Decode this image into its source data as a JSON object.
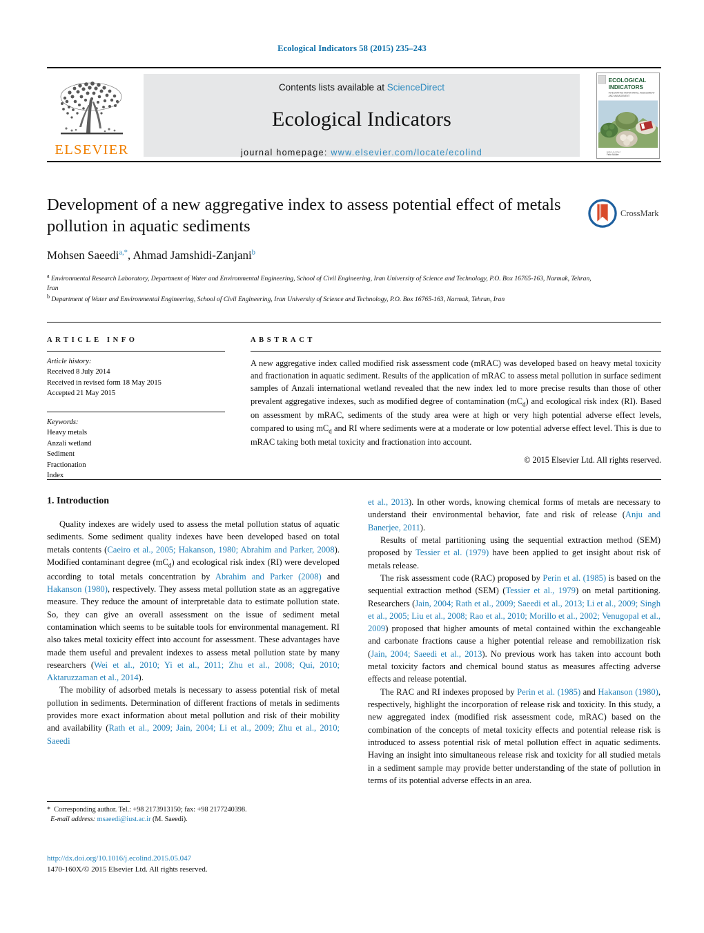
{
  "running_head": "Ecological Indicators 58 (2015) 235–243",
  "masthead": {
    "publisher_name": "ELSEVIER",
    "contents_prefix": "Contents lists available at ",
    "contents_link": "ScienceDirect",
    "journal_name": "Ecological Indicators",
    "homepage_prefix": "journal homepage: ",
    "homepage_url": "www.elsevier.com/locate/ecolind",
    "cover_title_line1": "ECOLOGICAL",
    "cover_title_line2": "INDICATORS",
    "cover_subtitle": "INTEGRATING MONITORING, ASSESSMENT AND MANAGEMENT"
  },
  "article": {
    "title": "Development of a new aggregative index to assess potential effect of metals pollution in aquatic sediments",
    "crossmark_label": "CrossMark",
    "authors_html": "Mohsen Saeedi<sup>a,*</sup>, Ahmad Jamshidi-Zanjani<sup>b</sup>",
    "affiliation_a": "Environmental Research Laboratory, Department of Water and Environmental Engineering, School of Civil Engineering, Iran University of Science and Technology, P.O. Box 16765-163, Narmak, Tehran, Iran",
    "affiliation_b": "Department of Water and Environmental Engineering, School of Civil Engineering, Iran University of Science and Technology, P.O. Box 16765-163, Narmak, Tehran, Iran"
  },
  "article_info": {
    "label": "ARTICLE INFO",
    "history_label": "Article history:",
    "history": [
      "Received 8 July 2014",
      "Received in revised form 18 May 2015",
      "Accepted 21 May 2015"
    ],
    "keywords_label": "Keywords:",
    "keywords": [
      "Heavy metals",
      "Anzali wetland",
      "Sediment",
      "Fractionation",
      "Index"
    ]
  },
  "abstract": {
    "label": "ABSTRACT",
    "text_html": "A new aggregative index called modified risk assessment code (mRAC) was developed based on heavy metal toxicity and fractionation in aquatic sediment. Results of the application of mRAC to assess metal pollution in surface sediment samples of Anzali international wetland revealed that the new index led to more precise results than those of other prevalent aggregative indexes, such as modified degree of contamination (mC<sub>d</sub>) and ecological risk index (RI). Based on assessment by mRAC, sediments of the study area were at high or very high potential adverse effect levels, compared to using mC<sub>d</sub> and RI where sediments were at a moderate or low potential adverse effect level. This is due to mRAC taking both metal toxicity and fractionation into account.",
    "copyright": "© 2015 Elsevier Ltd. All rights reserved."
  },
  "body": {
    "section_heading": "1. Introduction",
    "left_paragraphs_html": [
      "Quality indexes are widely used to assess the metal pollution status of aquatic sediments. Some sediment quality indexes have been developed based on total metals contents (<span class=\"cite\">Caeiro et al., 2005; Hakanson, 1980; Abrahim and Parker, 2008</span>). Modified contaminant degree (mC<sub>d</sub>) and ecological risk index (RI) were developed according to total metals concentration by <span class=\"cite\">Abrahim and Parker (2008)</span> and <span class=\"cite\">Hakanson (1980)</span>, respectively. They assess metal pollution state as an aggregative measure. They reduce the amount of interpretable data to estimate pollution state. So, they can give an overall assessment on the issue of sediment metal contamination which seems to be suitable tools for environmental management. RI also takes metal toxicity effect into account for assessment. These advantages have made them useful and prevalent indexes to assess metal pollution state by many researchers (<span class=\"cite\">Wei et al., 2010; Yi et al., 2011; Zhu et al., 2008; Qui, 2010; Aktaruzzaman et al., 2014</span>).",
      "The mobility of adsorbed metals is necessary to assess potential risk of metal pollution in sediments. Determination of different fractions of metals in sediments provides more exact information about metal pollution and risk of their mobility and availability (<span class=\"cite\">Rath et al., 2009; Jain, 2004; Li et al., 2009; Zhu et al., 2010; Saeedi</span>"
    ],
    "right_paragraphs_html": [
      "<span class=\"cite\">et al., 2013</span>). In other words, knowing chemical forms of metals are necessary to understand their environmental behavior, fate and risk of release (<span class=\"cite\">Anju and Banerjee, 2011</span>).",
      "Results of metal partitioning using the sequential extraction method (SEM) proposed by <span class=\"cite\">Tessier et al. (1979)</span> have been applied to get insight about risk of metals release.",
      "The risk assessment code (RAC) proposed by <span class=\"cite\">Perin et al. (1985)</span> is based on the sequential extraction method (SEM) (<span class=\"cite\">Tessier et al., 1979</span>) on metal partitioning. Researchers (<span class=\"cite\">Jain, 2004; Rath et al., 2009; Saeedi et al., 2013; Li et al., 2009; Singh et al., 2005; Liu et al., 2008; Rao et al., 2010; Morillo et al., 2002; Venugopal et al., 2009</span>) proposed that higher amounts of metal contained within the exchangeable and carbonate fractions cause a higher potential release and remobilization risk (<span class=\"cite\">Jain, 2004; Saeedi et al., 2013</span>). No previous work has taken into account both metal toxicity factors and chemical bound status as measures affecting adverse effects and release potential.",
      "The RAC and RI indexes proposed by <span class=\"cite\">Perin et al. (1985)</span> and <span class=\"cite\">Hakanson (1980)</span>, respectively, highlight the incorporation of release risk and toxicity. In this study, a new aggregated index (modified risk assessment code, mRAC) based on the combination of the concepts of metal toxicity effects and potential release risk is introduced to assess potential risk of metal pollution effect in aquatic sediments. Having an insight into simultaneous release risk and toxicity for all studied metals in a sediment sample may provide better understanding of the state of pollution in terms of its potential adverse effects in an area."
    ]
  },
  "footnotes": {
    "corresponding_html": "<span class=\"star\">*</span>&nbsp; Corresponding author. Tel.: +98 2173913150; fax: +98 2177240398.",
    "email_label": "E-mail address:",
    "email": "msaeedi@iust.ac.ir",
    "email_suffix": "(M. Saeedi).",
    "doi": "http://dx.doi.org/10.1016/j.ecolind.2015.05.047",
    "issn_line": "1470-160X/© 2015 Elsevier Ltd. All rights reserved."
  },
  "colors": {
    "link_blue": "#1f7fb8",
    "header_blue": "#0b6ea8",
    "elsevier_orange": "#f08000",
    "mast_gray": "#e6e7e8"
  }
}
